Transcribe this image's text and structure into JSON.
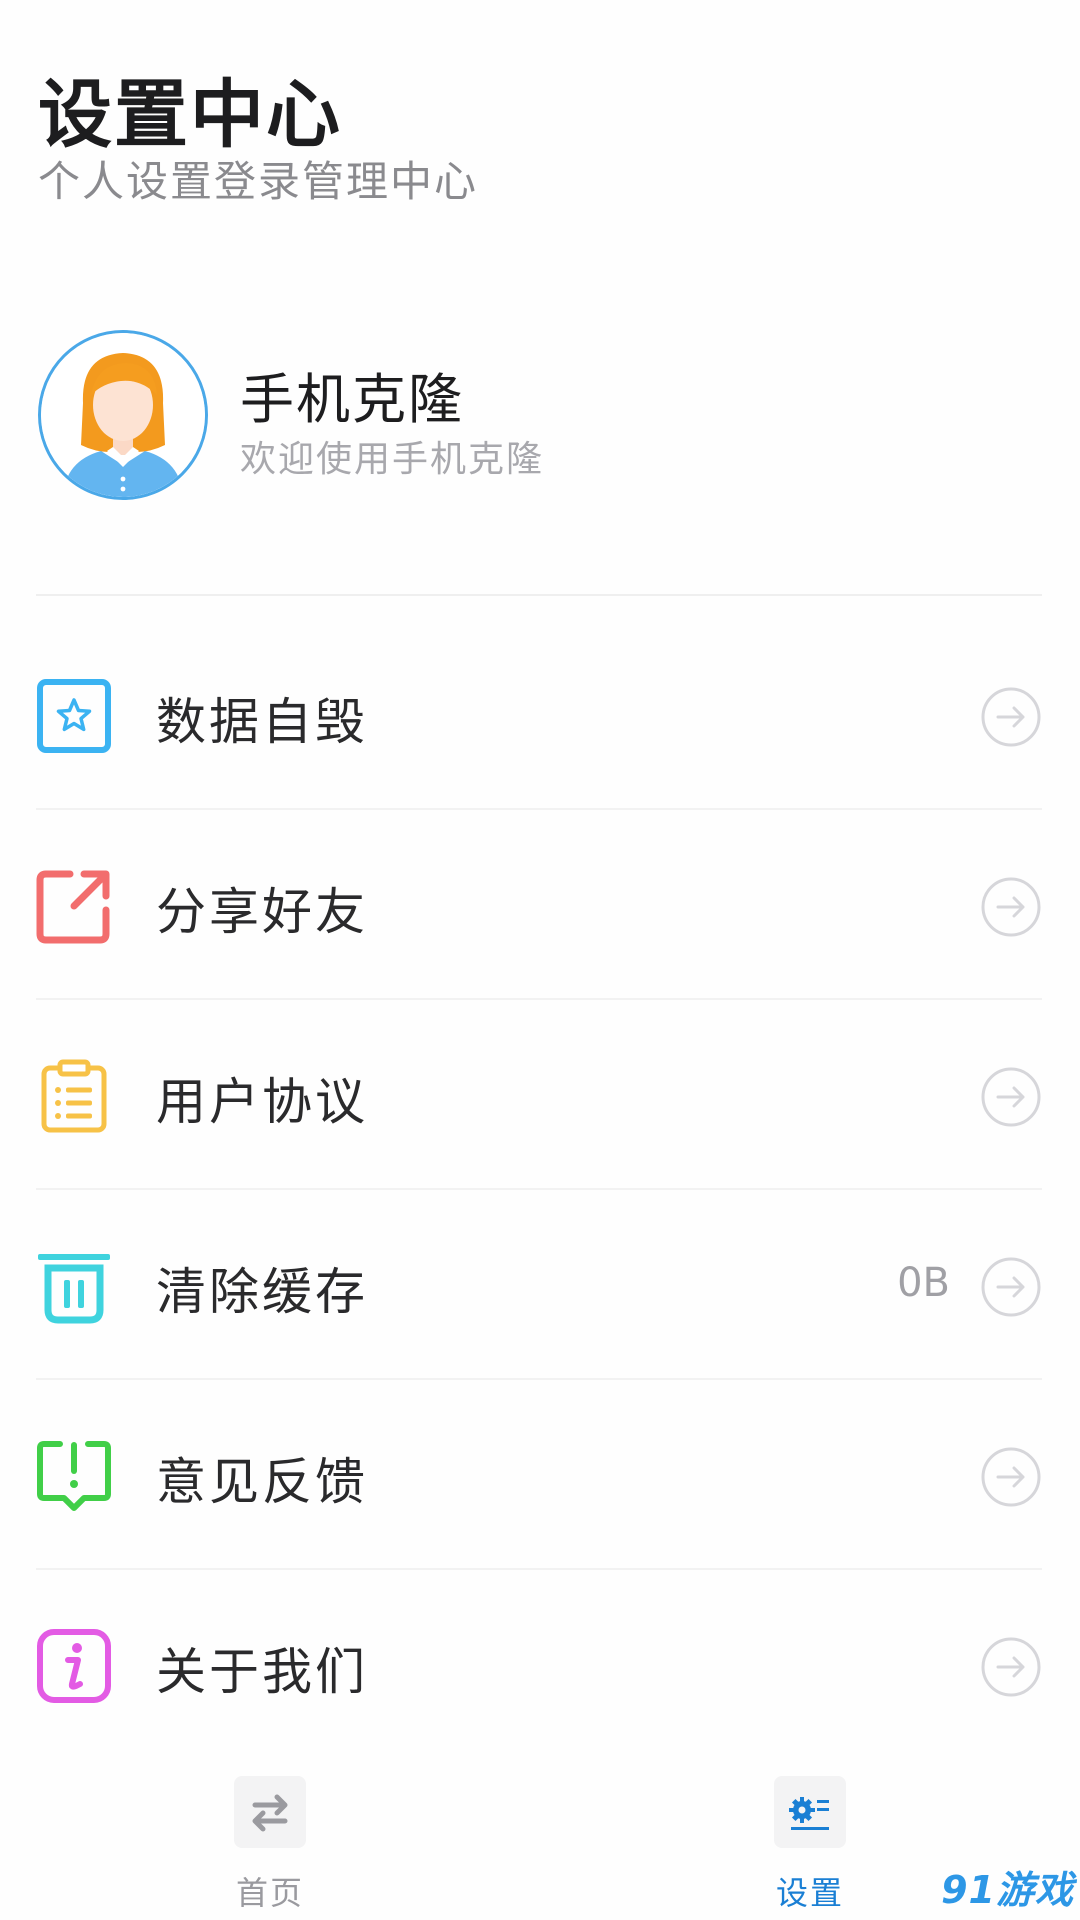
{
  "header": {
    "title": "设置中心",
    "subtitle": "个人设置登录管理中心"
  },
  "profile": {
    "name": "手机克隆",
    "description": "欢迎使用手机克隆",
    "avatar_icon": "female-avatar-icon"
  },
  "menu": {
    "items": [
      {
        "label": "数据自毁",
        "icon": "star-icon",
        "color": "#3bb3f2",
        "value": ""
      },
      {
        "label": "分享好友",
        "icon": "share-icon",
        "color": "#f26d6d",
        "value": ""
      },
      {
        "label": "用户协议",
        "icon": "clipboard-icon",
        "color": "#f7c247",
        "value": ""
      },
      {
        "label": "清除缓存",
        "icon": "trash-icon",
        "color": "#3fd3de",
        "value": "0B"
      },
      {
        "label": "意见反馈",
        "icon": "feedback-icon",
        "color": "#41cf48",
        "value": ""
      },
      {
        "label": "关于我们",
        "icon": "info-icon",
        "color": "#e35be4",
        "value": ""
      }
    ],
    "arrow_icon": "arrow-right-circle-icon"
  },
  "tabbar": {
    "tabs": [
      {
        "label": "首页",
        "icon": "swap-arrows-icon",
        "active": false
      },
      {
        "label": "设置",
        "icon": "settings-gear-icon",
        "active": true
      }
    ],
    "active_color": "#1a7fd4"
  },
  "watermark": "91游戏"
}
